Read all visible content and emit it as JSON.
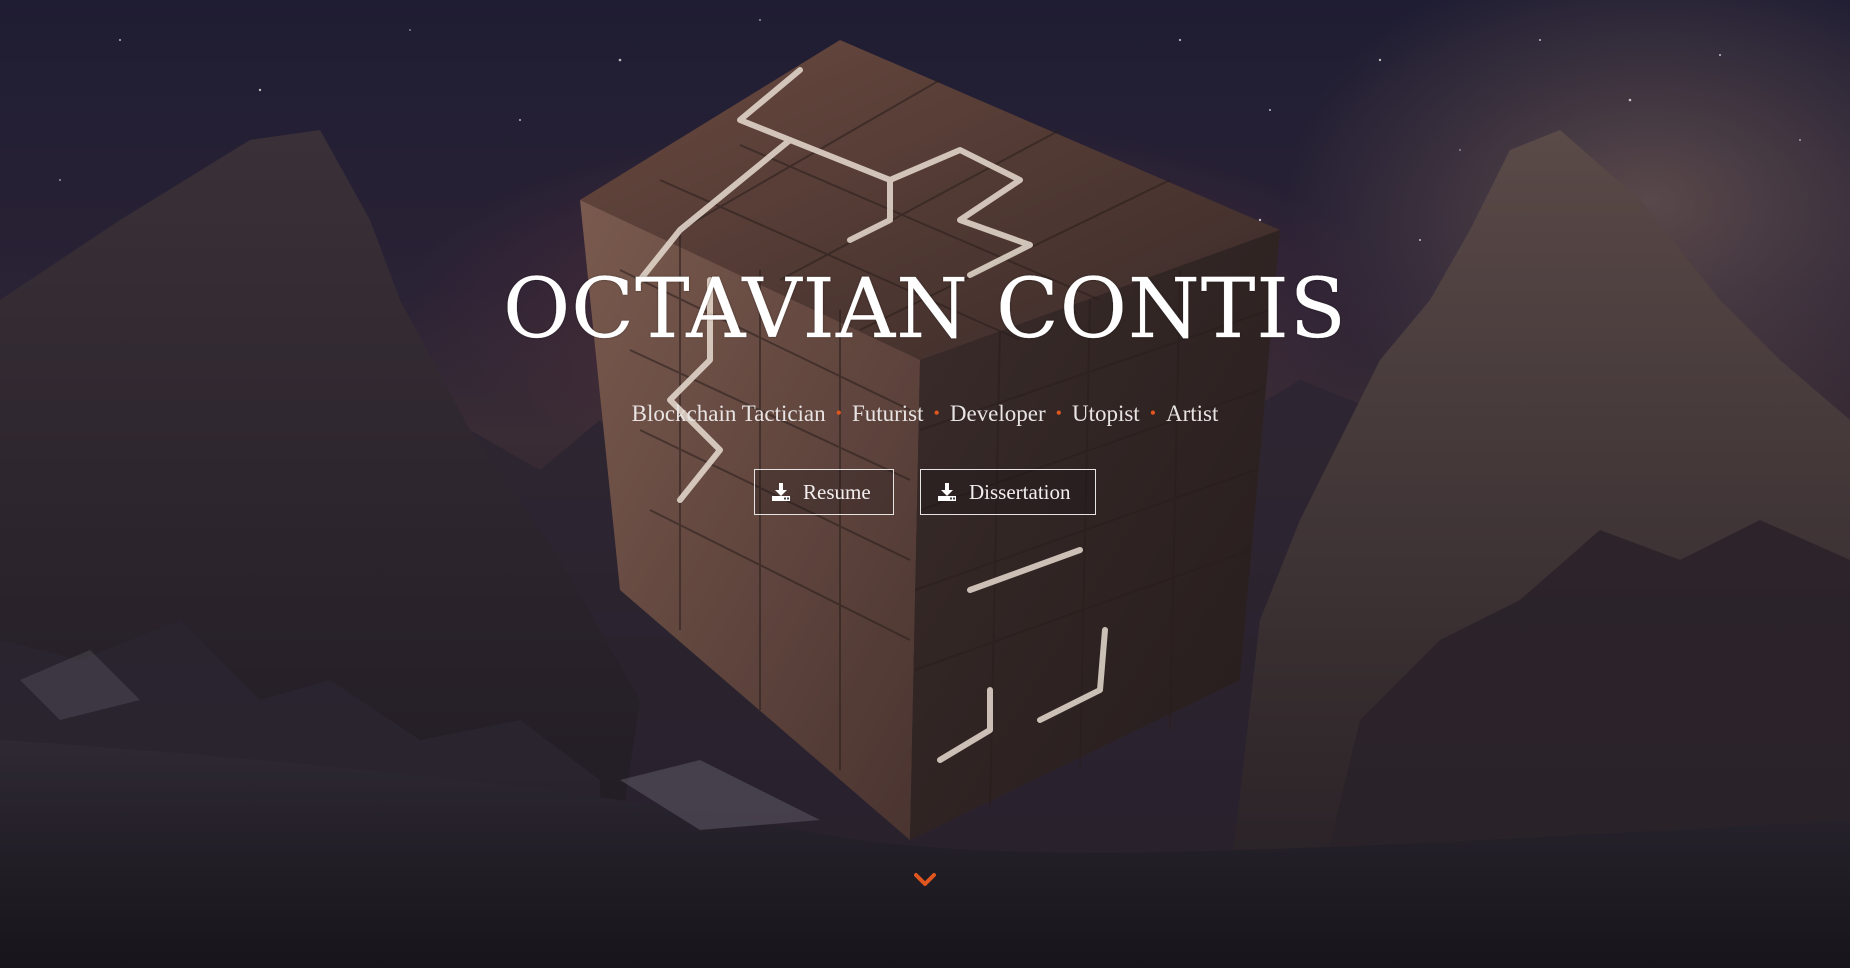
{
  "hero": {
    "title": "OCTAVIAN CONTIS",
    "roles": [
      "Blockchain Tactician",
      "Futurist",
      "Developer",
      "Utopist",
      "Artist"
    ],
    "separator": "•"
  },
  "buttons": {
    "resume": {
      "label": "Resume",
      "icon": "download-icon"
    },
    "dissertation": {
      "label": "Dissertation",
      "icon": "download-icon"
    }
  },
  "scroll": {
    "icon": "chevron-down-icon"
  },
  "colors": {
    "accent": "#e0561e",
    "text": "#ffffff",
    "button_border": "#e8e3e3"
  }
}
